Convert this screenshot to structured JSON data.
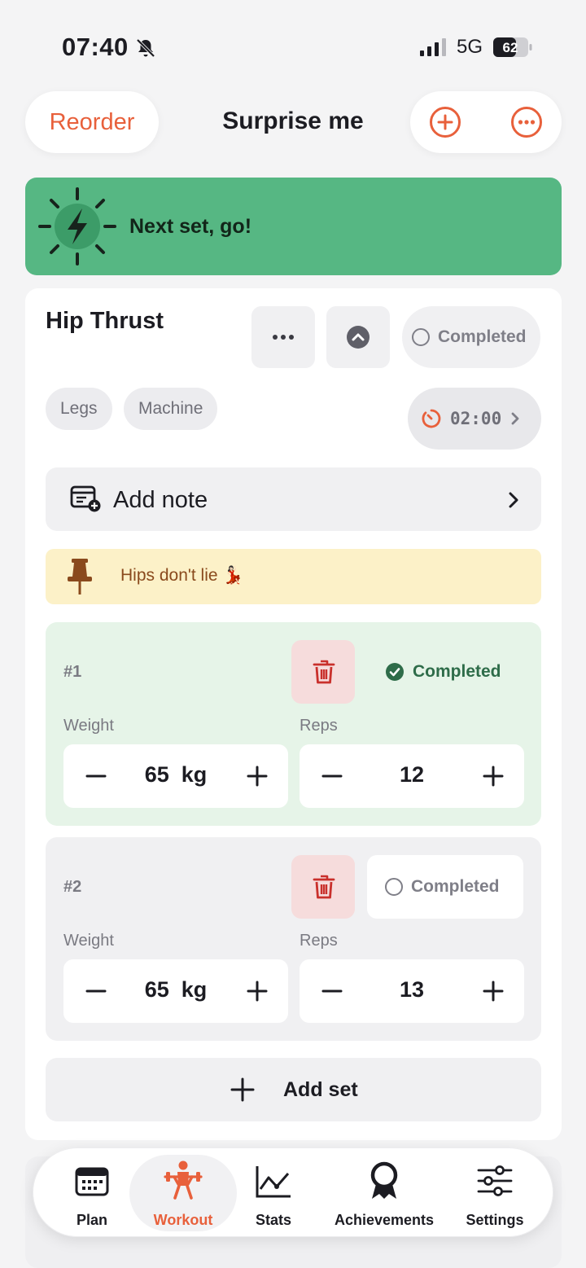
{
  "status_bar": {
    "time": "07:40",
    "network": "5G",
    "battery": "62"
  },
  "header": {
    "reorder_label": "Reorder",
    "title": "Surprise me"
  },
  "banner": {
    "text": "Next set, go!"
  },
  "exercise": {
    "name": "Hip Thrust",
    "completed_label": "Completed",
    "tags": [
      "Legs",
      "Machine"
    ],
    "rest_timer": "02:00",
    "add_note_label": "Add note",
    "pinned_note": "Hips don't lie 💃🏻",
    "sets": [
      {
        "number": "#1",
        "status": "Completed",
        "completed": true,
        "weight_label": "Weight",
        "weight_value": "65",
        "weight_unit": "kg",
        "reps_label": "Reps",
        "reps_value": "12"
      },
      {
        "number": "#2",
        "status": "Completed",
        "completed": false,
        "weight_label": "Weight",
        "weight_value": "65",
        "weight_unit": "kg",
        "reps_label": "Reps",
        "reps_value": "13"
      }
    ],
    "add_set_label": "Add set"
  },
  "tabbar": {
    "active": "Workout",
    "items": [
      {
        "label": "Plan",
        "icon": "calendar-icon"
      },
      {
        "label": "Workout",
        "icon": "weightlifter-icon"
      },
      {
        "label": "Stats",
        "icon": "chart-icon"
      },
      {
        "label": "Achievements",
        "icon": "award-ribbon-icon"
      },
      {
        "label": "Settings",
        "icon": "sliders-icon"
      }
    ]
  },
  "colors": {
    "accent": "#e8603b",
    "banner": "#56b783",
    "set_done_bg": "#e6f4e8",
    "done_text": "#2e6c49",
    "trash_bg": "#f6dcdc",
    "pin_bg": "#fcf1c8"
  }
}
